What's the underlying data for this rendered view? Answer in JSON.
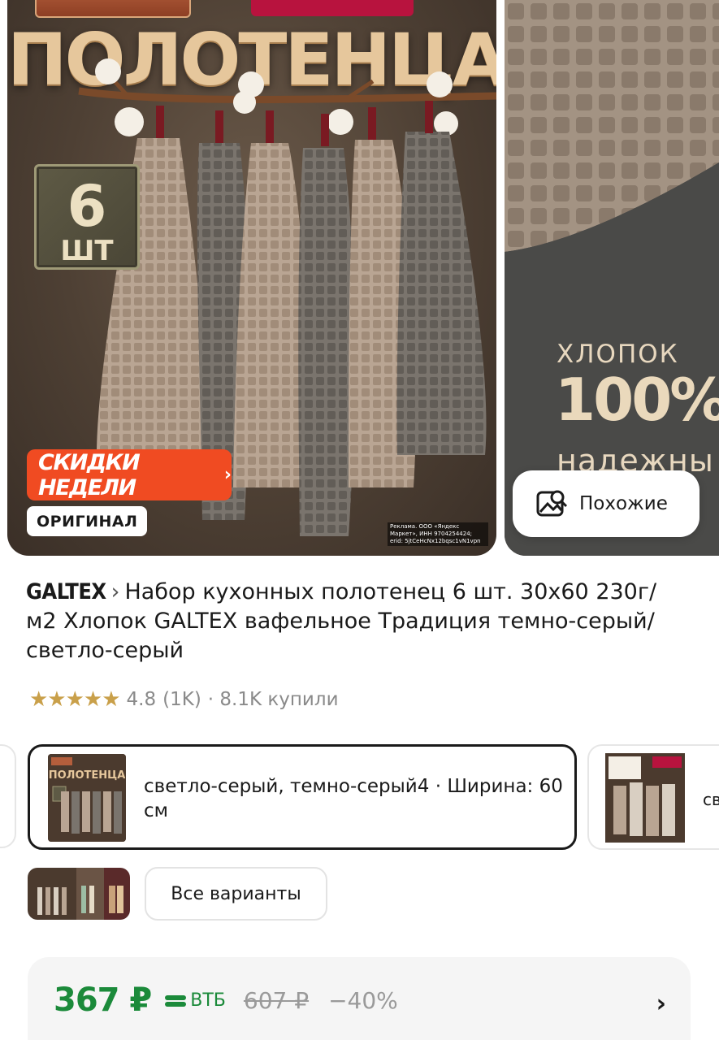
{
  "gallery": {
    "main": {
      "hero_title": "ПОЛОТЕНЦА",
      "count_number": "6",
      "count_unit": "ШТ",
      "sale_banner": "СКИДКИ НЕДЕЛИ",
      "original_badge": "ОРИГИНАЛ",
      "ad_note": "Реклама. ООО «Яндекс Маркет», ИНН 9704254424; erid: 5jtCeHcNx12bqsc1vN1vpn"
    },
    "second": {
      "cotton_label": "ХЛОПОК",
      "cotton_percent": "100%",
      "cotton_more": "надежны"
    },
    "similar_button": "Похожие"
  },
  "product": {
    "brand": "GALTEX",
    "title": "Набор кухонных полотенец 6 шт. 30х60 230г/м2 Хлопок GALTEX вафельное Традиция темно-серый/светло-серый",
    "rating": "4.8",
    "reviews": "(1K)",
    "bought": "· 8.1K купили"
  },
  "variants": {
    "selected_label": "светло-серый, темно-серый4 · Ширина: 60 см",
    "next_label_partial": "св",
    "all_variants_button": "Все варианты"
  },
  "price": {
    "current": "367 ₽",
    "bank": "ВТБ",
    "old": "607 ₽",
    "discount": "−40%"
  },
  "colors": {
    "price_green": "#1b8a3a",
    "sale_orange": "#f04b22",
    "star_gold": "#c9a04a"
  }
}
